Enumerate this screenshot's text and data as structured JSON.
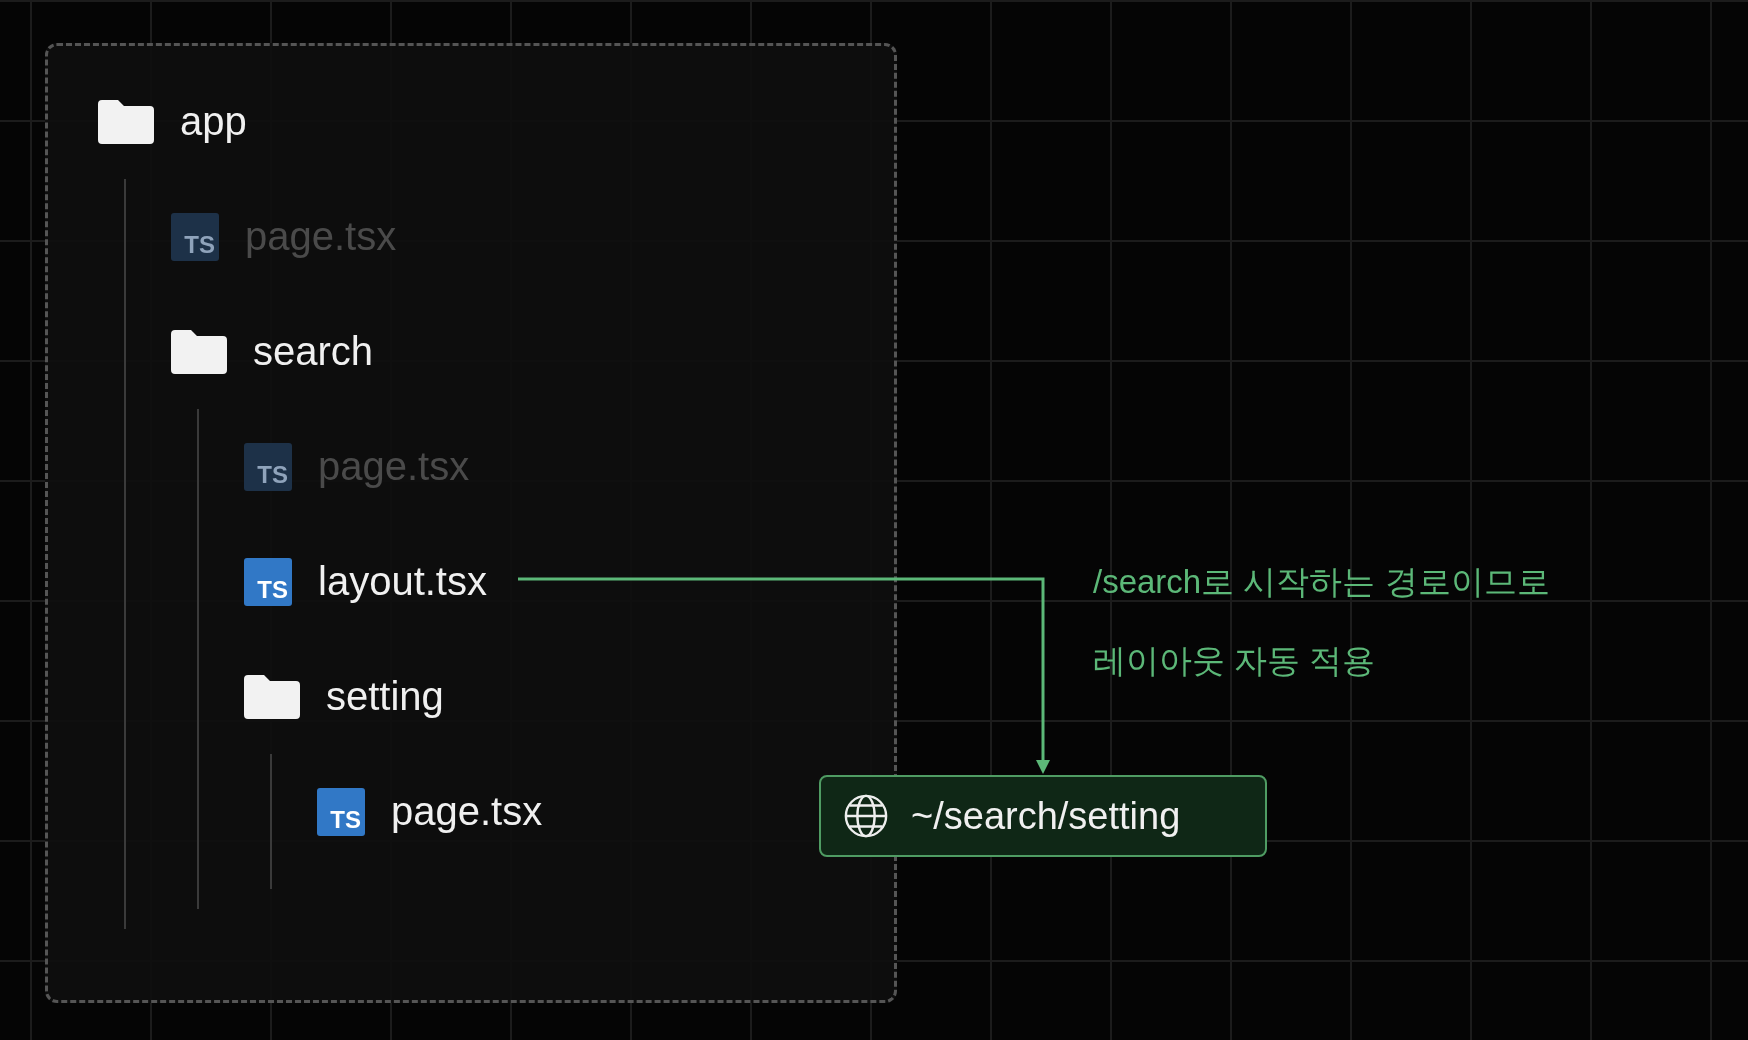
{
  "tree": [
    {
      "kind": "folder",
      "name": "app",
      "dimmed": false,
      "children": [
        {
          "kind": "file",
          "name": "page.tsx",
          "badge": "TS",
          "dimmed": true
        },
        {
          "kind": "folder",
          "name": "search",
          "dimmed": false,
          "children": [
            {
              "kind": "file",
              "name": "page.tsx",
              "badge": "TS",
              "dimmed": true
            },
            {
              "kind": "file",
              "name": "layout.tsx",
              "badge": "TS",
              "dimmed": false
            },
            {
              "kind": "folder",
              "name": "setting",
              "dimmed": false,
              "children": [
                {
                  "kind": "file",
                  "name": "page.tsx",
                  "badge": "TS",
                  "dimmed": false
                }
              ]
            }
          ]
        }
      ]
    }
  ],
  "annotation": [
    "/search로 시작하는 경로이므로",
    "레이아웃 자동 적용"
  ],
  "url": "~/search/setting"
}
